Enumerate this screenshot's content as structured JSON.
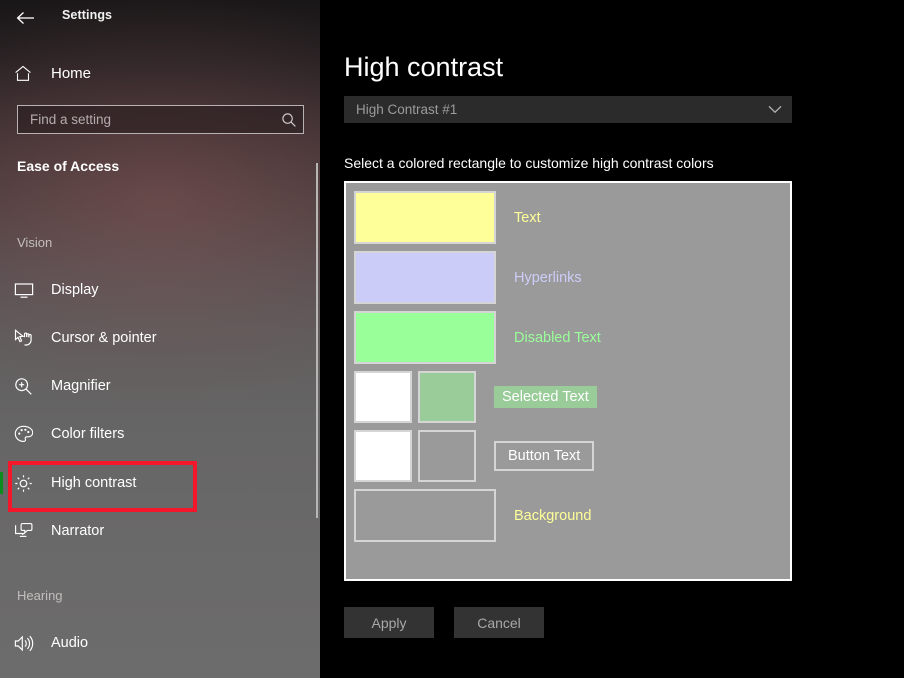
{
  "window": {
    "title": "Settings",
    "back_icon": "back-arrow-icon"
  },
  "sidebar": {
    "home": {
      "label": "Home",
      "icon": "home-icon"
    },
    "search": {
      "value": "",
      "placeholder": "Find a setting",
      "icon": "search-icon"
    },
    "category_heading": "Ease of Access",
    "groups": [
      {
        "label": "Vision",
        "items": [
          {
            "label": "Display",
            "icon": "monitor-icon",
            "selected": false
          },
          {
            "label": "Cursor & pointer",
            "icon": "cursor-pointer-icon",
            "selected": false
          },
          {
            "label": "Magnifier",
            "icon": "magnifier-icon",
            "selected": false
          },
          {
            "label": "Color filters",
            "icon": "palette-icon",
            "selected": false
          },
          {
            "label": "High contrast",
            "icon": "brightness-sun-icon",
            "selected": true
          },
          {
            "label": "Narrator",
            "icon": "narrator-monitor-speech-icon",
            "selected": false
          }
        ]
      },
      {
        "label": "Hearing",
        "items": [
          {
            "label": "Audio",
            "icon": "speaker-volume-icon",
            "selected": false
          }
        ]
      }
    ],
    "selection_indicator_color": "#0c8c1e",
    "scrollbar_color": "#b8b5b5"
  },
  "annotation": {
    "target": "High contrast",
    "color": "#f4162a"
  },
  "main": {
    "title": "High contrast",
    "theme_dropdown": {
      "value": "High Contrast #1",
      "chevron_icon": "chevron-down-icon"
    },
    "instruction": "Select a colored rectangle to customize high contrast colors",
    "panel": {
      "background_color": "#9a9a9a",
      "border_color": "#ffffff",
      "swatch_border_color": "#d5d5d5",
      "rows": [
        {
          "name": "text",
          "label": "Text",
          "label_style": "plain",
          "label_color": "#ffff99",
          "swatches": [
            {
              "name": "text-color-swatch",
              "color": "#ffff99",
              "shape": "wide"
            }
          ]
        },
        {
          "name": "hyperlinks",
          "label": "Hyperlinks",
          "label_style": "plain",
          "label_color": "#ccccf9",
          "swatches": [
            {
              "name": "hyperlink-color-swatch",
              "color": "#ccccf9",
              "shape": "wide"
            }
          ]
        },
        {
          "name": "disabled-text",
          "label": "Disabled Text",
          "label_style": "plain",
          "label_color": "#99ff99",
          "swatches": [
            {
              "name": "disabled-text-color-swatch",
              "color": "#99ff99",
              "shape": "wide"
            }
          ]
        },
        {
          "name": "selected-text",
          "label": "Selected Text",
          "label_style": "filled",
          "label_color": "#ffffff",
          "label_background": "#99cc99",
          "swatches": [
            {
              "name": "selected-text-foreground-swatch",
              "color": "#ffffff",
              "shape": "square"
            },
            {
              "name": "selected-text-background-swatch",
              "color": "#99cc99",
              "shape": "square"
            }
          ]
        },
        {
          "name": "button-text",
          "label": "Button Text",
          "label_style": "boxed",
          "label_color": "#ffffff",
          "swatches": [
            {
              "name": "button-text-foreground-swatch",
              "color": "#ffffff",
              "shape": "square"
            },
            {
              "name": "button-text-background-swatch",
              "color": "#9a9a9a",
              "shape": "square"
            }
          ]
        },
        {
          "name": "background",
          "label": "Background",
          "label_style": "plain",
          "label_color": "#ffff99",
          "swatches": [
            {
              "name": "background-color-swatch",
              "color": "#9a9a9a",
              "shape": "wide"
            }
          ]
        }
      ]
    },
    "buttons": [
      {
        "name": "apply-button",
        "label": "Apply"
      },
      {
        "name": "cancel-button",
        "label": "Cancel"
      }
    ]
  }
}
